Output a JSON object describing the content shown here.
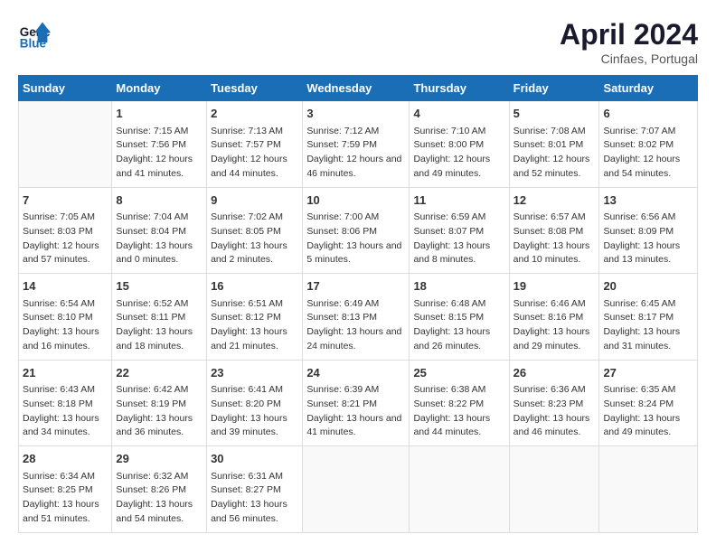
{
  "header": {
    "logo_line1": "General",
    "logo_line2": "Blue",
    "month_title": "April 2024",
    "location": "Cinfaes, Portugal"
  },
  "weekdays": [
    "Sunday",
    "Monday",
    "Tuesday",
    "Wednesday",
    "Thursday",
    "Friday",
    "Saturday"
  ],
  "weeks": [
    [
      {
        "day": "",
        "empty": true
      },
      {
        "day": "1",
        "sunrise": "7:15 AM",
        "sunset": "7:56 PM",
        "daylight": "12 hours and 41 minutes."
      },
      {
        "day": "2",
        "sunrise": "7:13 AM",
        "sunset": "7:57 PM",
        "daylight": "12 hours and 44 minutes."
      },
      {
        "day": "3",
        "sunrise": "7:12 AM",
        "sunset": "7:59 PM",
        "daylight": "12 hours and 46 minutes."
      },
      {
        "day": "4",
        "sunrise": "7:10 AM",
        "sunset": "8:00 PM",
        "daylight": "12 hours and 49 minutes."
      },
      {
        "day": "5",
        "sunrise": "7:08 AM",
        "sunset": "8:01 PM",
        "daylight": "12 hours and 52 minutes."
      },
      {
        "day": "6",
        "sunrise": "7:07 AM",
        "sunset": "8:02 PM",
        "daylight": "12 hours and 54 minutes."
      }
    ],
    [
      {
        "day": "7",
        "sunrise": "7:05 AM",
        "sunset": "8:03 PM",
        "daylight": "12 hours and 57 minutes."
      },
      {
        "day": "8",
        "sunrise": "7:04 AM",
        "sunset": "8:04 PM",
        "daylight": "13 hours and 0 minutes."
      },
      {
        "day": "9",
        "sunrise": "7:02 AM",
        "sunset": "8:05 PM",
        "daylight": "13 hours and 2 minutes."
      },
      {
        "day": "10",
        "sunrise": "7:00 AM",
        "sunset": "8:06 PM",
        "daylight": "13 hours and 5 minutes."
      },
      {
        "day": "11",
        "sunrise": "6:59 AM",
        "sunset": "8:07 PM",
        "daylight": "13 hours and 8 minutes."
      },
      {
        "day": "12",
        "sunrise": "6:57 AM",
        "sunset": "8:08 PM",
        "daylight": "13 hours and 10 minutes."
      },
      {
        "day": "13",
        "sunrise": "6:56 AM",
        "sunset": "8:09 PM",
        "daylight": "13 hours and 13 minutes."
      }
    ],
    [
      {
        "day": "14",
        "sunrise": "6:54 AM",
        "sunset": "8:10 PM",
        "daylight": "13 hours and 16 minutes."
      },
      {
        "day": "15",
        "sunrise": "6:52 AM",
        "sunset": "8:11 PM",
        "daylight": "13 hours and 18 minutes."
      },
      {
        "day": "16",
        "sunrise": "6:51 AM",
        "sunset": "8:12 PM",
        "daylight": "13 hours and 21 minutes."
      },
      {
        "day": "17",
        "sunrise": "6:49 AM",
        "sunset": "8:13 PM",
        "daylight": "13 hours and 24 minutes."
      },
      {
        "day": "18",
        "sunrise": "6:48 AM",
        "sunset": "8:15 PM",
        "daylight": "13 hours and 26 minutes."
      },
      {
        "day": "19",
        "sunrise": "6:46 AM",
        "sunset": "8:16 PM",
        "daylight": "13 hours and 29 minutes."
      },
      {
        "day": "20",
        "sunrise": "6:45 AM",
        "sunset": "8:17 PM",
        "daylight": "13 hours and 31 minutes."
      }
    ],
    [
      {
        "day": "21",
        "sunrise": "6:43 AM",
        "sunset": "8:18 PM",
        "daylight": "13 hours and 34 minutes."
      },
      {
        "day": "22",
        "sunrise": "6:42 AM",
        "sunset": "8:19 PM",
        "daylight": "13 hours and 36 minutes."
      },
      {
        "day": "23",
        "sunrise": "6:41 AM",
        "sunset": "8:20 PM",
        "daylight": "13 hours and 39 minutes."
      },
      {
        "day": "24",
        "sunrise": "6:39 AM",
        "sunset": "8:21 PM",
        "daylight": "13 hours and 41 minutes."
      },
      {
        "day": "25",
        "sunrise": "6:38 AM",
        "sunset": "8:22 PM",
        "daylight": "13 hours and 44 minutes."
      },
      {
        "day": "26",
        "sunrise": "6:36 AM",
        "sunset": "8:23 PM",
        "daylight": "13 hours and 46 minutes."
      },
      {
        "day": "27",
        "sunrise": "6:35 AM",
        "sunset": "8:24 PM",
        "daylight": "13 hours and 49 minutes."
      }
    ],
    [
      {
        "day": "28",
        "sunrise": "6:34 AM",
        "sunset": "8:25 PM",
        "daylight": "13 hours and 51 minutes."
      },
      {
        "day": "29",
        "sunrise": "6:32 AM",
        "sunset": "8:26 PM",
        "daylight": "13 hours and 54 minutes."
      },
      {
        "day": "30",
        "sunrise": "6:31 AM",
        "sunset": "8:27 PM",
        "daylight": "13 hours and 56 minutes."
      },
      {
        "day": "",
        "empty": true
      },
      {
        "day": "",
        "empty": true
      },
      {
        "day": "",
        "empty": true
      },
      {
        "day": "",
        "empty": true
      }
    ]
  ],
  "labels": {
    "sunrise_label": "Sunrise:",
    "sunset_label": "Sunset:",
    "daylight_label": "Daylight:"
  }
}
